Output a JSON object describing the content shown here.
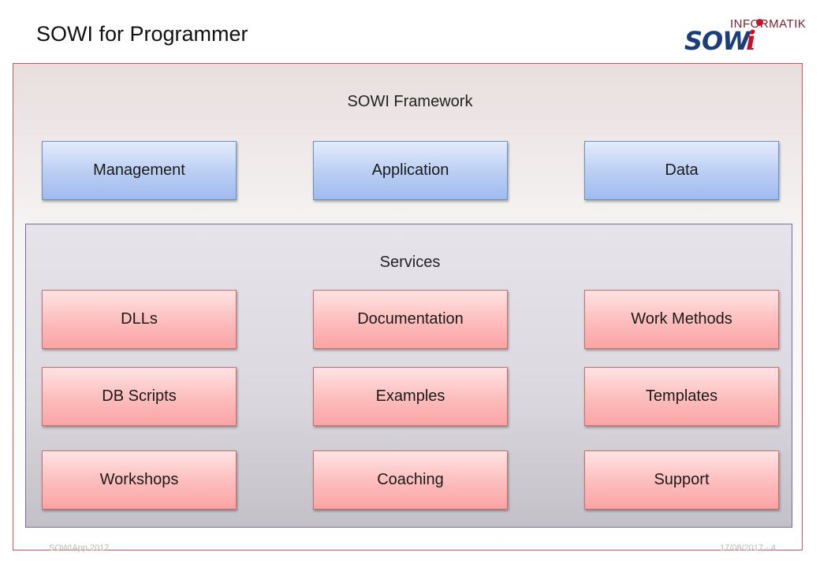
{
  "slide": {
    "title": "SOWI for Programmer"
  },
  "logo": {
    "top_text": "INFORMATIK",
    "main_text": "SOW",
    "accent_text": "i",
    "accent_color": "#c3132b",
    "main_color": "#1b3e7a"
  },
  "framework": {
    "title": "SOWI Framework",
    "modules": [
      "Management",
      "Application",
      "Data"
    ]
  },
  "services": {
    "title": "Services",
    "items": [
      "DLLs",
      "Documentation",
      "Work Methods",
      "DB Scripts",
      "Examples",
      "Templates",
      "Workshops",
      "Coaching",
      "Support"
    ]
  },
  "footer": {
    "left": "SOWIApp 2017",
    "right": "17/08/2017 - 4"
  },
  "colors": {
    "module_fill": "#b9cdf2",
    "service_fill": "#fdbcbc",
    "framework_border": "#c9585a",
    "services_border": "#7b6b93"
  }
}
